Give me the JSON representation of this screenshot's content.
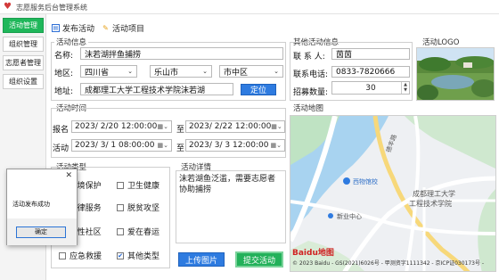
{
  "window": {
    "title": "志愿服务后台管理系统"
  },
  "sidebar": {
    "items": [
      {
        "label": "活动管理",
        "active": true
      },
      {
        "label": "组织管理"
      },
      {
        "label": "志愿者管理"
      },
      {
        "label": "组织设置"
      }
    ]
  },
  "tabs": [
    {
      "label": "发布活动"
    },
    {
      "label": "活动项目"
    }
  ],
  "activity_info": {
    "title": "活动信息",
    "name_label": "名称:",
    "name_value": "沫若湖拌鱼捕捞",
    "region_label": "地区:",
    "province": "四川省",
    "city": "乐山市",
    "district": "市中区",
    "address_label": "地址:",
    "address_value": "成都理工大学工程技术学院沫若湖",
    "locate_button": "定位"
  },
  "other_info": {
    "title": "其他活动信息",
    "contact_label": "联 系 人:",
    "contact_value": "茵茵",
    "phone_label": "联系电话:",
    "phone_value": "0833-7820666",
    "recruit_label": "招募数量:",
    "recruit_value": "30"
  },
  "logo": {
    "title": "活动LOGO"
  },
  "activity_time": {
    "title": "活动时间",
    "signup_label": "报名",
    "signup_start": "2023/ 2/20 12:00:00",
    "signup_end": "2023/ 2/22 12:00:00",
    "activity_label": "活动",
    "activity_start": "2023/ 3/ 1 08:00:00",
    "activity_end": "2023/ 3/ 3 12:00:00",
    "to_label": "至"
  },
  "activity_map": {
    "title": "活动地图",
    "labels": {
      "school_name_1": "成都理工大学",
      "school_name_2": "工程技术学院",
      "poi_1": "西物馆校",
      "poi_2": "新业中心",
      "road": "德丰路"
    },
    "attribution": "© 2023 Baidu - GS(2021)6026号 - 甲测资字1111342 - 京ICP证030173号 -",
    "baidu_logo": "Baidu地图"
  },
  "activity_type": {
    "title": "活动类型",
    "options": [
      {
        "label": "...境保护",
        "checked": false
      },
      {
        "label": "卫生健康",
        "checked": false
      },
      {
        "label": "...律服务",
        "checked": false
      },
      {
        "label": "脱贫攻坚",
        "checked": false
      },
      {
        "label": "...性社区",
        "checked": false
      },
      {
        "label": "爱在春运",
        "checked": false
      },
      {
        "label": "应急救援",
        "checked": false
      },
      {
        "label": "其他类型",
        "checked": true
      }
    ]
  },
  "activity_details": {
    "title": "活动详情",
    "text": "沫若湖鱼泛滥，需要志愿者协助捕捞"
  },
  "actions": {
    "upload_button": "上传图片",
    "submit_button": "提交活动"
  },
  "dialog": {
    "message": "活动发布成功",
    "ok_button": "确定",
    "close": "✕"
  }
}
